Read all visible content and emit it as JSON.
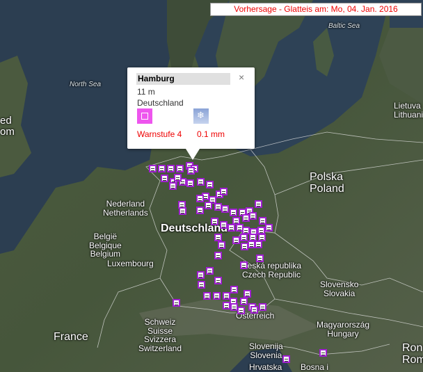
{
  "header": {
    "title": "Vorhersage - Glatteis am: Mo, 04. Jan. 2016"
  },
  "popup": {
    "name": "Hamburg",
    "elevation": "11 m",
    "country": "Deutschland",
    "warn_level": "Warnstufe 4",
    "amount": "0.1  mm",
    "close_glyph": "×",
    "icons": [
      "warning-level-icon",
      "freezing-rain-icon"
    ]
  },
  "map_labels": {
    "north_sea": "North Sea",
    "baltic_sea": "Baltic Sea",
    "united_kingdom_partial": "ed\nom",
    "lithuania": "Lietuva\nLithuania",
    "poland": "Polska\nPoland",
    "netherlands": "Nederland\nNetherlands",
    "belgium": "België\nBelgique\nBelgium",
    "luxembourg": "Luxembourg",
    "germany": "Deutschland",
    "czech": "Česká republika\nCzech Republic",
    "slovakia": "Slovensko\nSlovakia",
    "austria": "Österreich",
    "switzerland": "Schweiz\nSuisse\nSvizzera\nSwitzerland",
    "france": "France",
    "hungary": "Magyarország\nHungary",
    "slovenia": "Slovenija\nSlovenia",
    "croatia": "Hrvatska",
    "bosnia": "Bosna i",
    "romania": "Ron\nRom"
  },
  "colors": {
    "water": "#2b3d4f",
    "land": "#4a5a3e",
    "marker_border": "#a020d0",
    "warn": "#ee55ee",
    "title_text": "#ee0000"
  },
  "markers": {
    "icon": "freezing-rain-warning-marker",
    "count": 83
  }
}
